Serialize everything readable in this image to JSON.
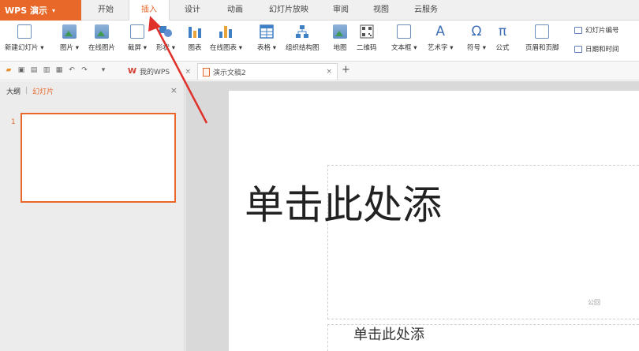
{
  "app": {
    "title": "WPS 演示",
    "brand_color": "#e8682a"
  },
  "menu": {
    "tabs": [
      {
        "label": "开始"
      },
      {
        "label": "插入",
        "active": true
      },
      {
        "label": "设计"
      },
      {
        "label": "动画"
      },
      {
        "label": "幻灯片放映"
      },
      {
        "label": "审阅"
      },
      {
        "label": "视图"
      },
      {
        "label": "云服务"
      }
    ]
  },
  "ribbon": {
    "new_slide": "新建幻灯片 ▾",
    "picture": "图片 ▾",
    "online_picture": "在线图片",
    "screenshot": "截屏 ▾",
    "shape": "形状 ▾",
    "chart": "图表",
    "online_chart": "在线图表 ▾",
    "table": "表格 ▾",
    "org_chart": "组织结构图",
    "map": "地图",
    "qrcode": "二维码",
    "textbox": "文本框 ▾",
    "wordart": "艺术字 ▾",
    "symbol": "符号 ▾",
    "formula": "公式",
    "header_footer": "页眉和页脚",
    "slide_number": "幻灯片编号",
    "date_time": "日期和时间",
    "wordart_glyph": "A",
    "symbol_glyph": "Ω",
    "formula_glyph": "π"
  },
  "doctabs": {
    "my_wps": "我的WPS",
    "doc2": "演示文稿2",
    "close": "×",
    "add": "+"
  },
  "panel": {
    "outline_tab": "大纲",
    "slides_tab": "幻灯片",
    "separator": "|",
    "close": "×",
    "slide_number": "1"
  },
  "slide": {
    "title_placeholder": "单击此处添",
    "subtitle_placeholder": "单击此处添",
    "watermark": "公回"
  },
  "colors": {
    "arrow": "#e0302a",
    "accent": "#e8682a"
  }
}
